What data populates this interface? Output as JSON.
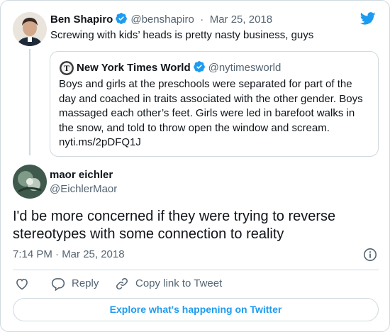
{
  "colors": {
    "accent": "#1d9bf0",
    "text": "#0f1419",
    "muted": "#536471",
    "border": "#cfd9de"
  },
  "parent_tweet": {
    "name": "Ben Shapiro",
    "handle": "@benshapiro",
    "separator": "·",
    "date": "Mar 25, 2018",
    "text": "Screwing with kids’ heads is pretty nasty business, guys",
    "verified": true
  },
  "quoted_tweet": {
    "name": "New York Times World",
    "handle": "@nytimesworld",
    "verified": true,
    "text": "Boys and girls at the preschools were separated for part of the day and coached in traits associated with the other gender. Boys massaged each other’s feet. Girls were led in barefoot walks in the snow, and told to throw open the window and scream. nyti.ms/2pDFQ1J"
  },
  "main_tweet": {
    "name": "maor eichler",
    "handle": "@EichlerMaor",
    "text": "I'd be more concerned if they were trying to reverse stereotypes with some connection to reality",
    "timestamp": "7:14 PM · Mar 25, 2018"
  },
  "actions": {
    "reply_label": "Reply",
    "copy_label": "Copy link to Tweet"
  },
  "explore_label": "Explore what's happening on Twitter",
  "icons": [
    "twitter-bird-icon",
    "verified-badge-icon",
    "info-icon",
    "heart-icon",
    "reply-icon",
    "link-icon"
  ]
}
